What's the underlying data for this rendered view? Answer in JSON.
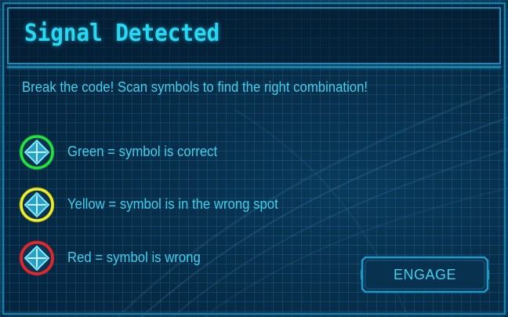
{
  "dialog": {
    "title": "Signal Detected",
    "instructions": "Break the code! Scan symbols to find the right combination!"
  },
  "legend": [
    {
      "ring_color": "#22e33a",
      "text": "Green = symbol is correct"
    },
    {
      "ring_color": "#f2ec25",
      "text": "Yellow = symbol is in the wrong spot"
    },
    {
      "ring_color": "#e8262a",
      "text": "Red = symbol is wrong"
    }
  ],
  "engage_button": {
    "label": "ENGAGE"
  },
  "colors": {
    "accent": "#27d8f4",
    "text": "#3fd0ec",
    "frame": "#1a7fa8",
    "panel": "#062a45"
  },
  "icons": {
    "legend_symbol": "diamond-crosshair-icon"
  }
}
